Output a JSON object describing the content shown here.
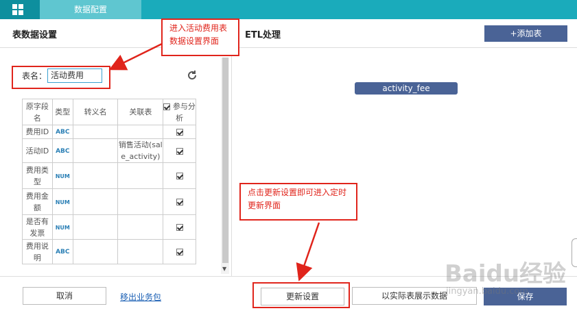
{
  "topbar": {
    "tab_label": "数据配置"
  },
  "left_panel": {
    "title": "表数据设置",
    "name_label": "表名：",
    "name_value": "活动费用"
  },
  "etl": {
    "title": "ETL处理",
    "add_table": "+添加表",
    "node": "activity_fee"
  },
  "table": {
    "headers": [
      "原字段名",
      "类型",
      "转义名",
      "关联表",
      "参与分析"
    ],
    "rows": [
      {
        "field": "费用ID",
        "type": "ABC",
        "alias": "",
        "relation": "",
        "analyze": true
      },
      {
        "field": "活动ID",
        "type": "ABC",
        "alias": "",
        "relation": "销售活动(sale_activity)",
        "analyze": true
      },
      {
        "field": "费用类型",
        "type": "NUM",
        "alias": "",
        "relation": "",
        "analyze": true
      },
      {
        "field": "费用金额",
        "type": "NUM",
        "alias": "",
        "relation": "",
        "analyze": true
      },
      {
        "field": "是否有发票",
        "type": "NUM",
        "alias": "",
        "relation": "",
        "analyze": true
      },
      {
        "field": "费用说明",
        "type": "ABC",
        "alias": "",
        "relation": "",
        "analyze": true
      }
    ]
  },
  "footer": {
    "cancel": "取消",
    "export": "移出业务包",
    "update": "更新设置",
    "show_data": "以实际表展示数据",
    "save": "保存"
  },
  "annotations": {
    "callout1": "进入活动费用表数据设置界面",
    "callout2": "点击更新设置即可进入定时更新界面",
    "color": "#e0241b"
  },
  "watermark": {
    "brand": "Baidu经验",
    "url": "jingyan.baidu.com"
  },
  "icons": [
    "grid-icon",
    "refresh-icon"
  ]
}
